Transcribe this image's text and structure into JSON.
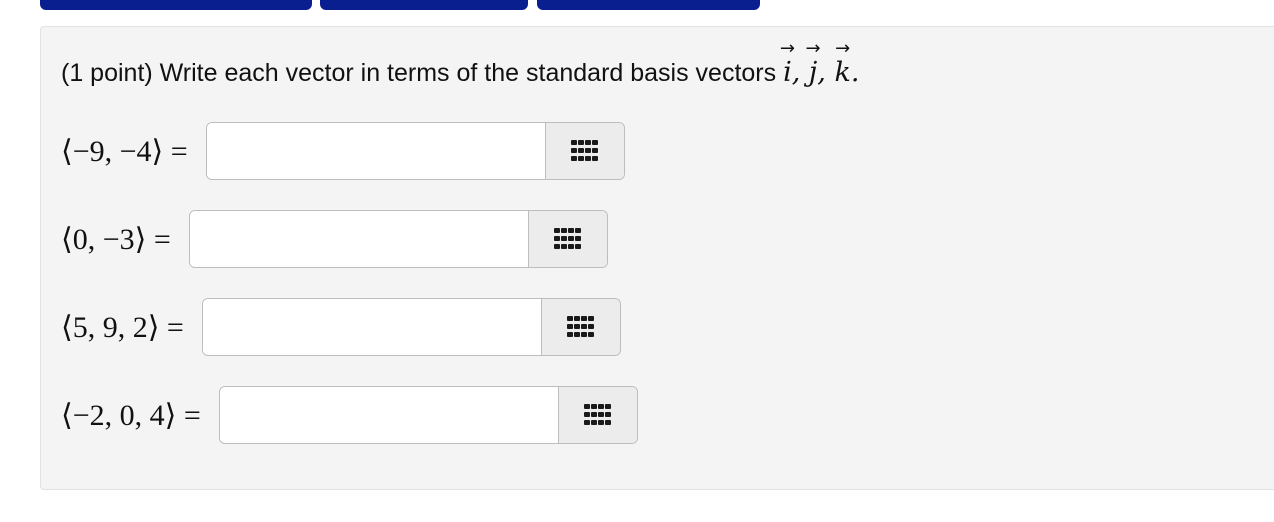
{
  "tabs": [
    {
      "label": ""
    },
    {
      "label": ""
    },
    {
      "label": ""
    }
  ],
  "problem": {
    "prompt_text": "(1 point) Write each vector in terms of the standard basis vectors",
    "basis_i": "i",
    "basis_j": "j",
    "basis_k": "k",
    "separator": ", ",
    "terminator": "."
  },
  "rows": [
    {
      "vector": "⟨−9, −4⟩",
      "equals": "=",
      "value": "",
      "placeholder": ""
    },
    {
      "vector": "⟨0, −3⟩",
      "equals": "=",
      "value": "",
      "placeholder": ""
    },
    {
      "vector": "⟨5, 9, 2⟩",
      "equals": "=",
      "value": "",
      "placeholder": ""
    },
    {
      "vector": "⟨−2, 0, 4⟩",
      "equals": "=",
      "value": "",
      "placeholder": ""
    }
  ],
  "icons": {
    "palette": "grid-icon"
  },
  "colors": {
    "tab_navy": "#0a1f8f",
    "panel_bg": "#f4f4f4",
    "palette_bg": "#ececec",
    "icon_color": "#1a1a1a"
  }
}
